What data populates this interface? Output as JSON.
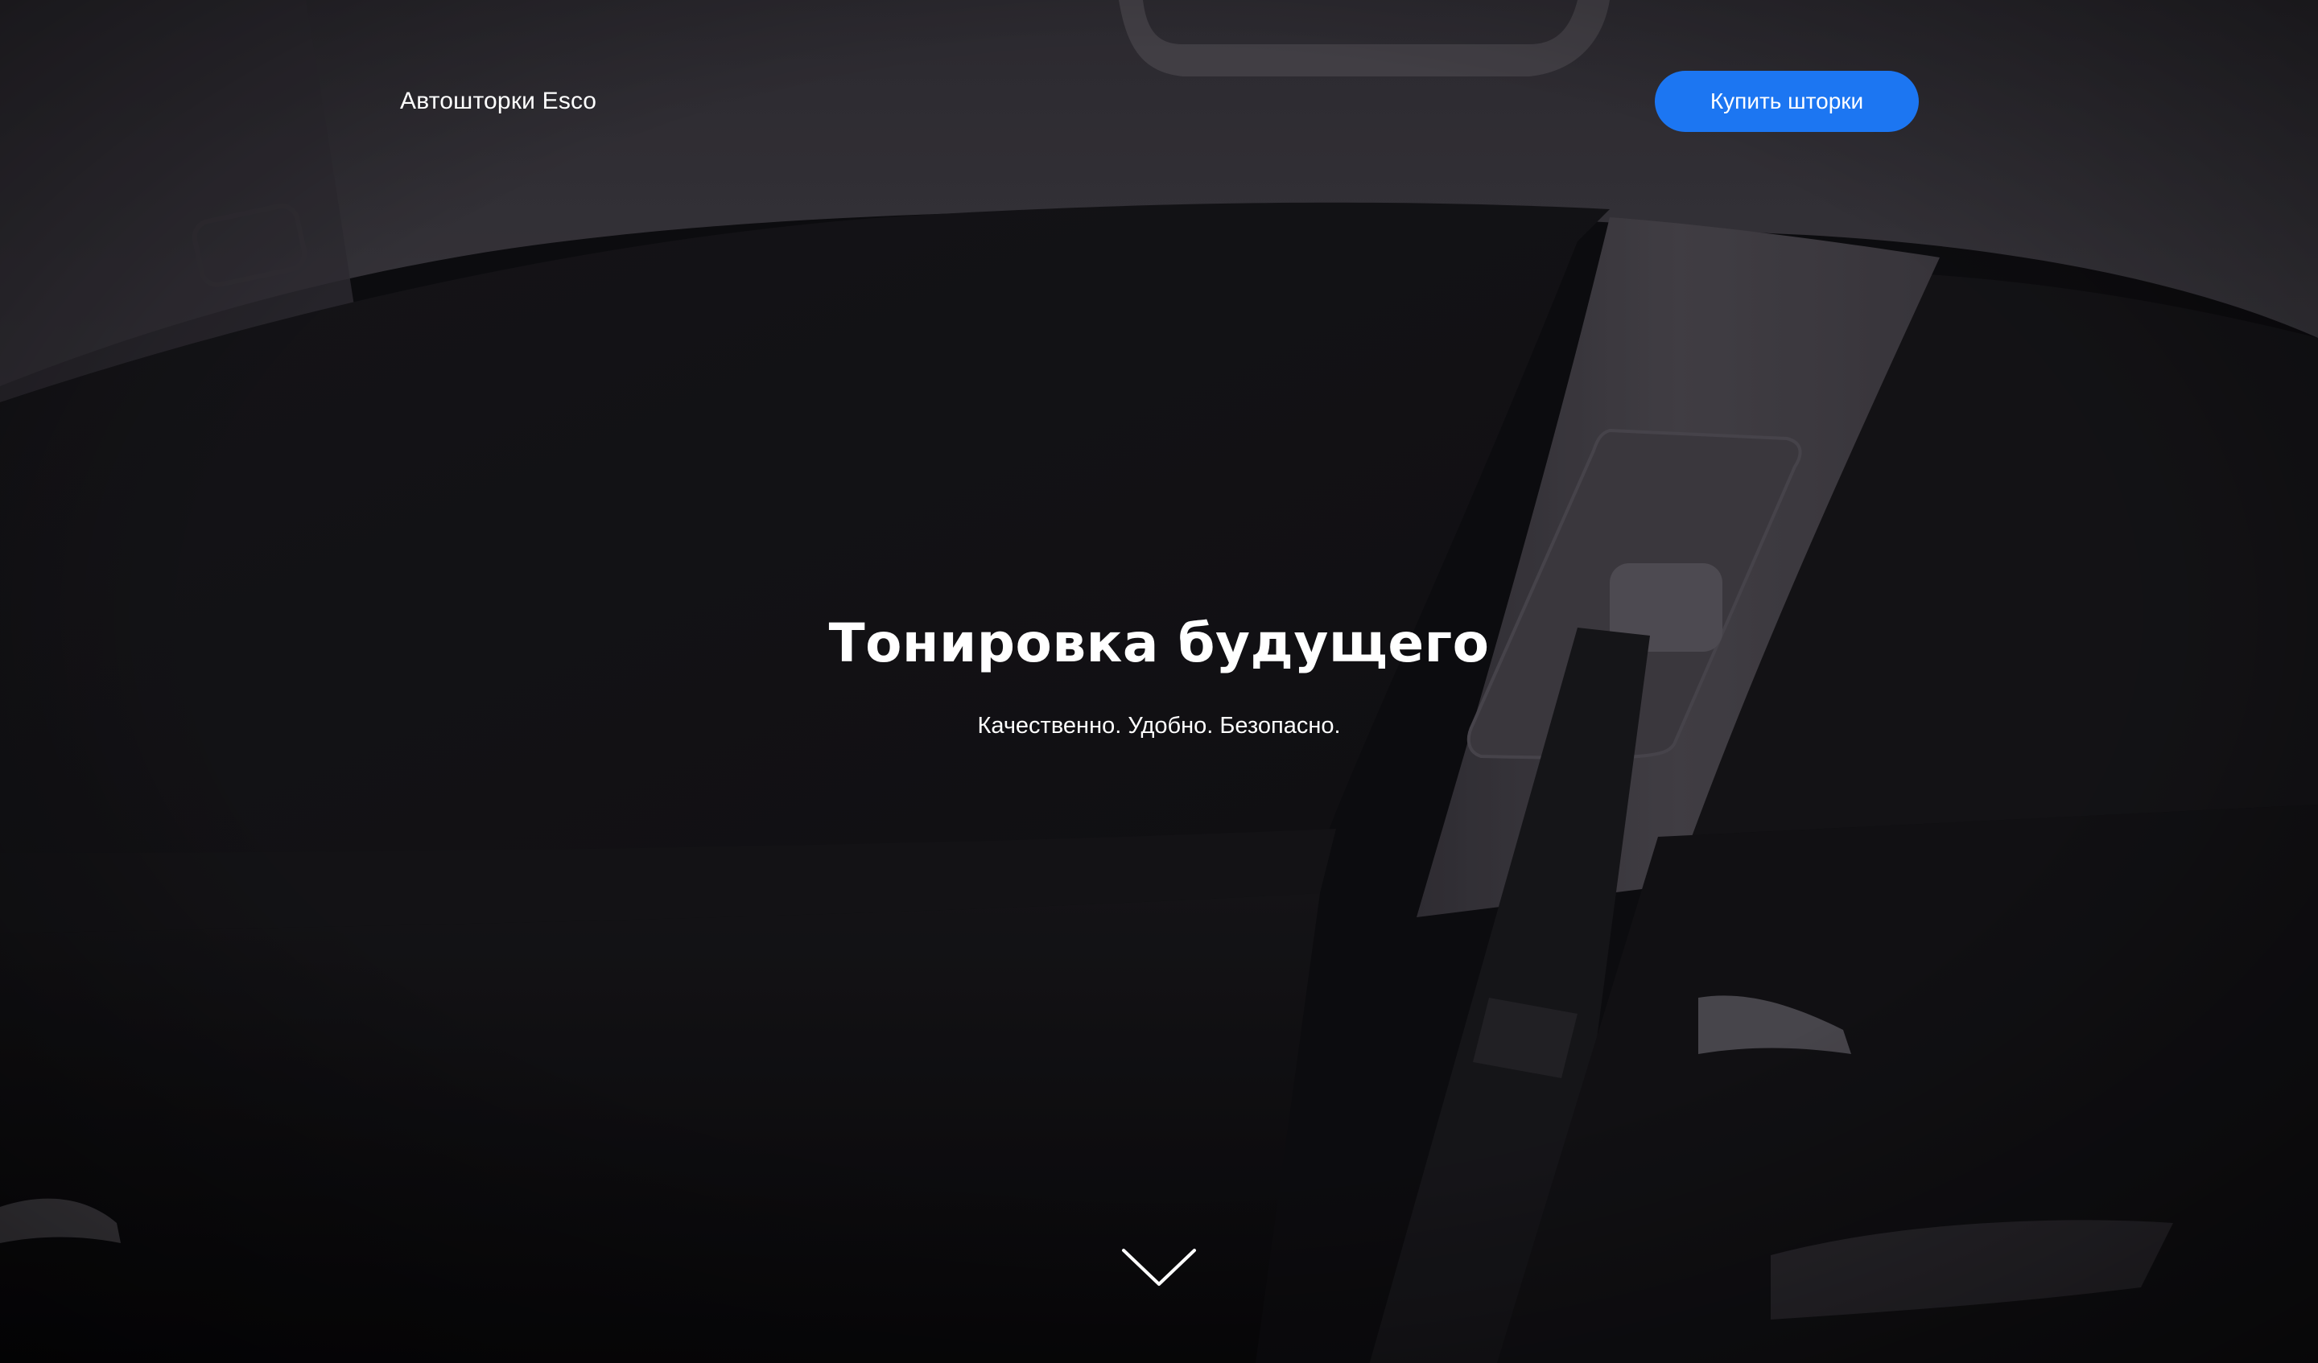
{
  "header": {
    "logo_text": "Автошторки Esco",
    "cta_label": "Купить шторки",
    "cta_color": "#1c76f2"
  },
  "hero": {
    "title": "Тонировка будущего",
    "subtitle": "Качественно. Удобно. Безопасно.",
    "background": "car-interior-photo",
    "scroll_icon": "chevron-down-icon"
  }
}
